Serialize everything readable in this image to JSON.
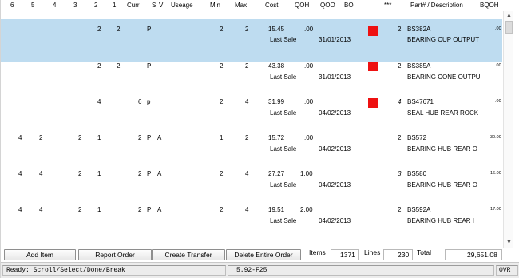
{
  "header": {
    "columns": [
      "6",
      "5",
      "4",
      "3",
      "2",
      "1",
      "Curr",
      "S",
      "V",
      "Useage",
      "Min",
      "Max",
      "Cost",
      "QOH",
      "QOO",
      "BO",
      "***",
      "Part# / Description",
      "BQOH"
    ]
  },
  "rows": [
    {
      "n2": "2",
      "n1": "2",
      "curr": "",
      "s": "P",
      "v": "",
      "useage": "",
      "min": "2",
      "max": "2",
      "cost": "15.45",
      "qoh": ".00",
      "last_sale_label": "Last Sale",
      "last_sale_date": "31/01/2013",
      "bo_flag": true,
      "star": "2",
      "part": "BS382A",
      "desc": "BEARING CUP OUTPUT",
      "bqoh": ".00",
      "selected": true
    },
    {
      "n2": "2",
      "n1": "2",
      "curr": "",
      "s": "P",
      "v": "",
      "useage": "",
      "min": "2",
      "max": "2",
      "cost": "43.38",
      "qoh": ".00",
      "last_sale_label": "Last Sale",
      "last_sale_date": "31/01/2013",
      "bo_flag": true,
      "star": "2",
      "part": "BS385A",
      "desc": "BEARING CONE OUTPU",
      "bqoh": ".00",
      "selected": false
    },
    {
      "n2": "4",
      "n1": "",
      "curr": "6",
      "s": "p",
      "v": "",
      "useage": "",
      "min": "2",
      "max": "4",
      "cost": "31.99",
      "qoh": ".00",
      "last_sale_label": "Last Sale",
      "last_sale_date": "04/02/2013",
      "bo_flag": true,
      "star": "4",
      "part": "BS47671",
      "desc": "SEAL HUB REAR ROCK",
      "bqoh": ".00",
      "selected": false
    },
    {
      "n6": "4",
      "n5": "2",
      "n3": "2",
      "n2": "1",
      "curr": "2",
      "s": "P",
      "v": "A",
      "min": "1",
      "max": "2",
      "cost": "15.72",
      "qoh": ".00",
      "last_sale_label": "Last Sale",
      "last_sale_date": "04/02/2013",
      "bo_flag": false,
      "star": "2",
      "part": "BS572",
      "desc": "BEARING HUB REAR O",
      "bqoh": "30.00",
      "selected": false
    },
    {
      "n6": "4",
      "n5": "4",
      "n3": "2",
      "n2": "1",
      "curr": "2",
      "s": "P",
      "v": "A",
      "min": "2",
      "max": "4",
      "cost": "27.27",
      "qoh": "1.00",
      "last_sale_label": "Last Sale",
      "last_sale_date": "04/02/2013",
      "bo_flag": false,
      "star": "3",
      "part": "BS580",
      "desc": "BEARING HUB REAR O",
      "bqoh": "16.00",
      "selected": false
    },
    {
      "n6": "4",
      "n5": "4",
      "n3": "2",
      "n2": "1",
      "curr": "2",
      "s": "P",
      "v": "A",
      "min": "2",
      "max": "4",
      "cost": "19.51",
      "qoh": "2.00",
      "last_sale_label": "Last Sale",
      "last_sale_date": "04/02/2013",
      "bo_flag": false,
      "star": "2",
      "part": "BS592A",
      "desc": "BEARING HUB REAR I",
      "bqoh": "17.00",
      "selected": false
    }
  ],
  "buttons": {
    "add_item": "Add Item",
    "report_order": "Report Order",
    "create_transfer": "Create Transfer",
    "delete_order": "Delete Entire Order"
  },
  "totals": {
    "items_label": "Items",
    "items_value": "1371",
    "lines_label": "Lines",
    "lines_value": "230",
    "total_label": "Total",
    "total_value": "29,651.08"
  },
  "status": {
    "prompt": "Ready: Scroll/Select/Done/Break",
    "version": "5.92-F25",
    "mode": "OVR"
  },
  "colors": {
    "selected_row": "#bedcf0",
    "bo_flag": "#ee1111"
  },
  "icons": {
    "scroll_up": "arrow-up-icon",
    "scroll_down": "arrow-down-icon"
  }
}
